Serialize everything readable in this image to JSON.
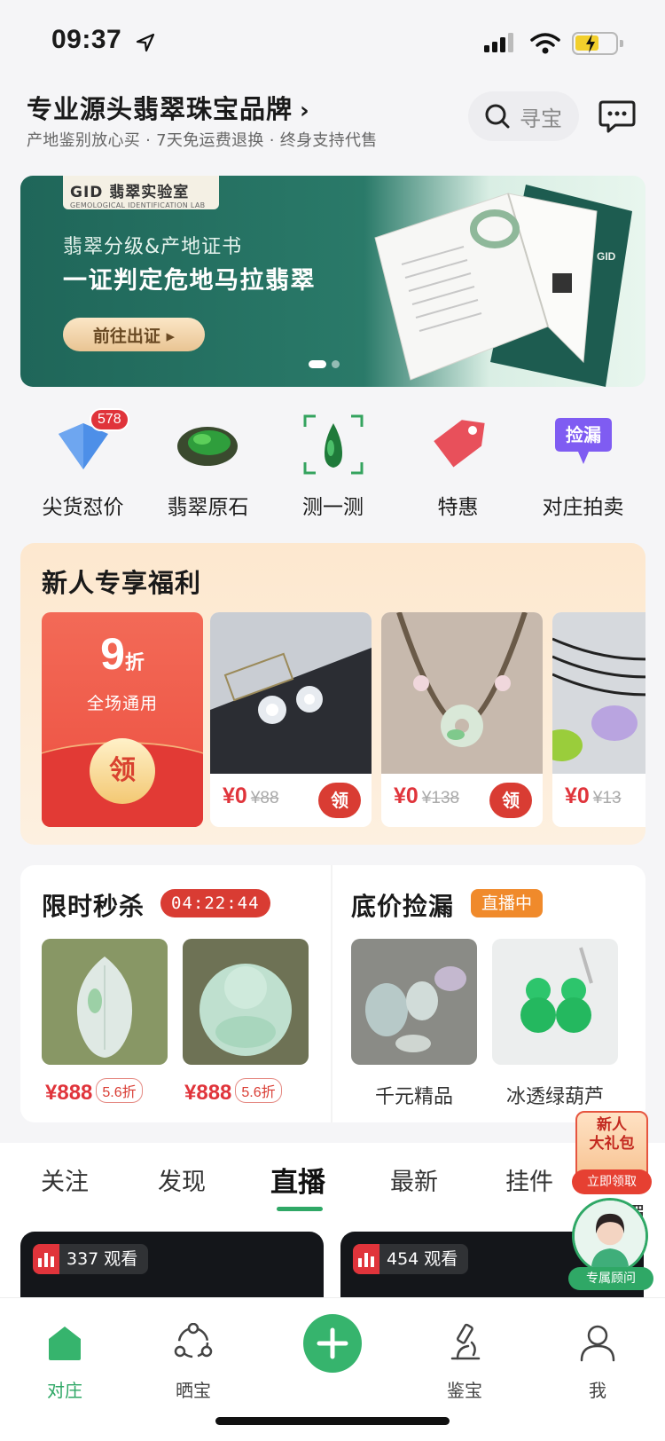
{
  "status_bar": {
    "time": "09:37"
  },
  "header": {
    "brand_title": "专业源头翡翠珠宝品牌",
    "brand_arrow": "›",
    "slogan": "产地鉴别放心买 · 7天免运费退换 · 终身支持代售",
    "search_placeholder": "寻宝"
  },
  "banner": {
    "lab_name": "GID 翡翠实验室",
    "lab_sub": "GEMOLOGICAL IDENTIFICATION LAB",
    "subtitle": "翡翠分级&产地证书",
    "title": "一证判定危地马拉翡翠",
    "button": "前往出证 ▸",
    "page_count": 2,
    "active_page": 1
  },
  "categories": [
    {
      "label": "尖货怼价",
      "icon": "diamond-icon",
      "badge": "578"
    },
    {
      "label": "翡翠原石",
      "icon": "raw-stone-icon"
    },
    {
      "label": "测一测",
      "icon": "scan-jade-icon"
    },
    {
      "label": "特惠",
      "icon": "tag-icon"
    },
    {
      "label": "对庄拍卖",
      "icon": "bargain-chat-icon",
      "icon_text": "捡漏"
    }
  ],
  "new_user": {
    "title": "新人专享福利",
    "coupon": {
      "discount": "9",
      "unit": "折",
      "desc": "全场通用",
      "action": "领"
    },
    "products": [
      {
        "price": "¥0",
        "orig": "¥88",
        "action": "领"
      },
      {
        "price": "¥0",
        "orig": "¥138",
        "action": "领"
      },
      {
        "price": "¥0",
        "orig": "¥13"
      }
    ]
  },
  "flash_sale": {
    "title": "限时秒杀",
    "countdown": "04:22:44",
    "items": [
      {
        "price": "¥888",
        "discount": "5.6折"
      },
      {
        "price": "¥888",
        "discount": "5.6折"
      }
    ]
  },
  "bargain": {
    "title": "底价捡漏",
    "tag": "直播中",
    "items": [
      {
        "label": "千元精品"
      },
      {
        "label": "冰透绿葫芦"
      }
    ]
  },
  "tabs": {
    "items": [
      "关注",
      "发现",
      "直播",
      "最新",
      "挂件",
      "手镯"
    ],
    "active_index": 2
  },
  "live": [
    {
      "viewers": "337 观看"
    },
    {
      "viewers": "454 观看"
    }
  ],
  "floaters": {
    "gift_title": "新人\n大礼包",
    "gift_line1": "新人",
    "gift_line2": "大礼包",
    "gift_button": "立即领取",
    "advisor_label": "专属顾问"
  },
  "bottom_nav": [
    {
      "label": "对庄",
      "icon": "home-icon",
      "active": true
    },
    {
      "label": "晒宝",
      "icon": "share-circle-icon"
    },
    {
      "label": "",
      "icon": "plus-icon"
    },
    {
      "label": "鉴宝",
      "icon": "microscope-icon"
    },
    {
      "label": "我",
      "icon": "profile-icon"
    }
  ],
  "colors": {
    "accent_green": "#2fa866",
    "price_red": "#e0343b",
    "banner_teal": "#1f6659"
  }
}
